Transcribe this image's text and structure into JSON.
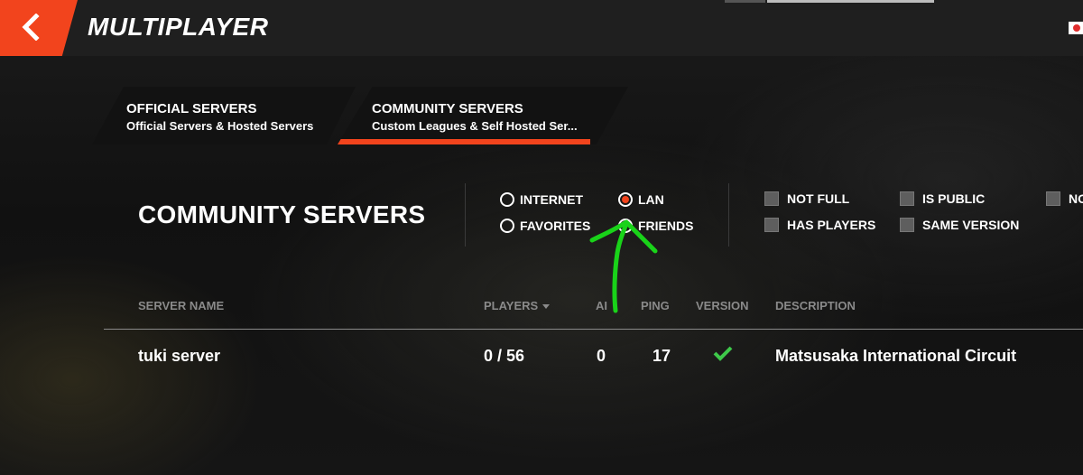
{
  "header": {
    "title": "MULTIPLAYER",
    "back_icon": "chevron-left-icon"
  },
  "tabs": [
    {
      "label": "OFFICIAL SERVERS",
      "subtitle": "Official Servers & Hosted Servers",
      "active": false
    },
    {
      "label": "COMMUNITY SERVERS",
      "subtitle": "Custom Leagues & Self Hosted Ser...",
      "active": true
    }
  ],
  "section_title": "COMMUNITY SERVERS",
  "source_filters": [
    {
      "label": "INTERNET",
      "selected": false
    },
    {
      "label": "LAN",
      "selected": true
    },
    {
      "label": "FAVORITES",
      "selected": false
    },
    {
      "label": "FRIENDS",
      "selected": false
    }
  ],
  "checkbox_filters": [
    {
      "label": "NOT FULL",
      "checked": false
    },
    {
      "label": "IS PUBLIC",
      "checked": false
    },
    {
      "label": "NO",
      "checked": false
    },
    {
      "label": "HAS PLAYERS",
      "checked": false
    },
    {
      "label": "SAME VERSION",
      "checked": false
    }
  ],
  "table": {
    "columns": [
      "SERVER NAME",
      "PLAYERS",
      "AI",
      "PING",
      "VERSION",
      "DESCRIPTION"
    ],
    "rows": [
      {
        "name": "tuki server",
        "players": "0 / 56",
        "ai": "0",
        "ping": "17",
        "version_ok": true,
        "description": "Matsusaka International Circuit"
      }
    ]
  },
  "colors": {
    "accent": "#f2441d",
    "annotation": "#19d319",
    "version_ok": "#3ec94a"
  }
}
